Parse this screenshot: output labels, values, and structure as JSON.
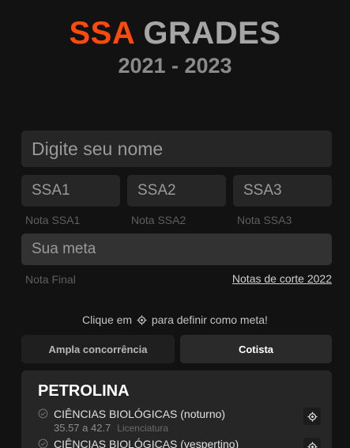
{
  "header": {
    "title_part1": "SSA",
    "title_part2": "GRADES",
    "years": "2021 - 2023"
  },
  "form": {
    "name_placeholder": "Digite seu nome",
    "ssa1_placeholder": "SSA1",
    "ssa2_placeholder": "SSA2",
    "ssa3_placeholder": "SSA3",
    "ssa1_label": "Nota SSA1",
    "ssa2_label": "Nota SSA2",
    "ssa3_label": "Nota SSA3",
    "meta_placeholder": "Sua meta",
    "final_label": "Nota Final",
    "cut_link": "Notas de corte 2022"
  },
  "hint": {
    "before": "Clique em",
    "after": "para definir como meta!",
    "icon": "target-icon"
  },
  "tabs": {
    "ampla": "Ampla concorrência",
    "cotista": "Cotista",
    "active": "cotista"
  },
  "results": {
    "city": "PETROLINA",
    "courses": [
      {
        "name": "CIÊNCIAS BIOLÓGICAS (noturno)",
        "range": "35.57 a 42.7",
        "degree": "Licenciatura"
      },
      {
        "name": "CIÊNCIAS BIOLÓGICAS (vespertino)",
        "range": "",
        "degree": ""
      }
    ]
  },
  "colors": {
    "accent": "#ff4a0d",
    "background": "#121212",
    "field": "#262626"
  }
}
